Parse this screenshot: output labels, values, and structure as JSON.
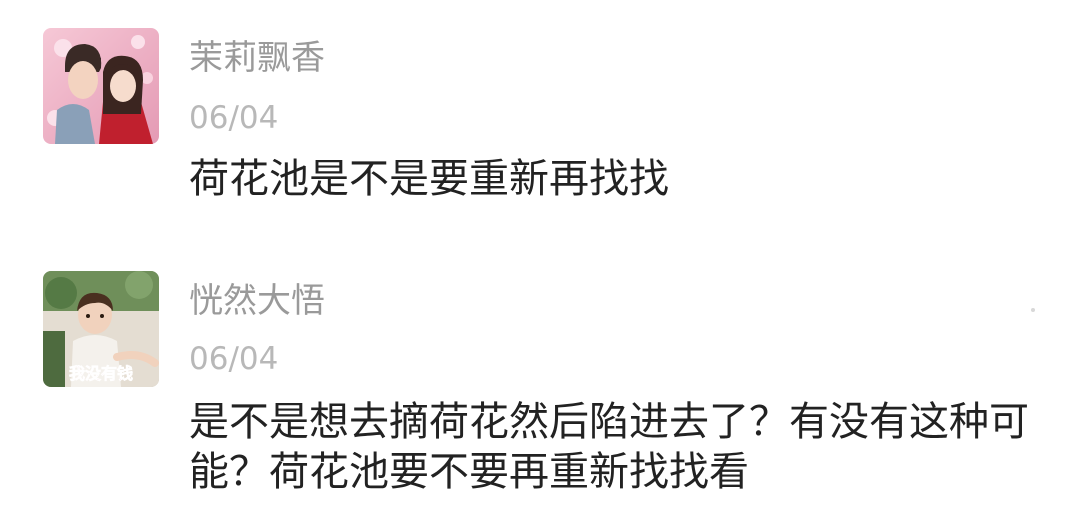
{
  "comments": [
    {
      "username": "茉莉飘香",
      "date": "06/04",
      "text": "荷花池是不是要重新再找找",
      "avatar_icon": "couple-photo-avatar"
    },
    {
      "username": "恍然大悟",
      "date": "06/04",
      "text": "是不是想去摘荷花然后陷进去了？有没有这种可能？荷花池要不要再重新找找看",
      "avatar_icon": "child-photo-avatar",
      "avatar_caption": "我没有钱"
    }
  ],
  "colors": {
    "username": "#9a9a9a",
    "date": "#b8b8b8",
    "text": "#222222",
    "avatar_caption": "#e0306a"
  }
}
